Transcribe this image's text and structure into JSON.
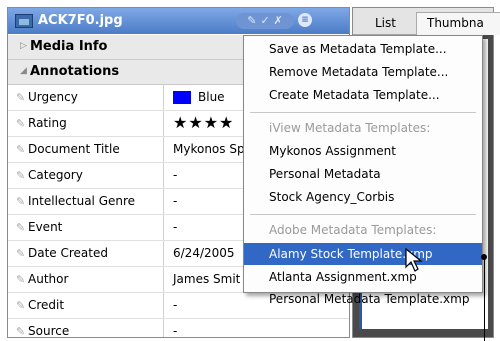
{
  "panel": {
    "filename": "ACK7F0.jpg",
    "tool_glyphs": "✓ ✗",
    "menu_glyph": "≡",
    "sections": {
      "media_info": "Media Info",
      "annotations": "Annotations"
    },
    "rows": [
      {
        "key": "Urgency",
        "value": "Blue",
        "swatch": "#0000ff"
      },
      {
        "key": "Rating",
        "value": "★★★★"
      },
      {
        "key": "Document Title",
        "value": "Mykonos Sp"
      },
      {
        "key": "Category",
        "value": "-"
      },
      {
        "key": "Intellectual Genre",
        "value": "-"
      },
      {
        "key": "Event",
        "value": "-"
      },
      {
        "key": "Date Created",
        "value": "6/24/2005"
      },
      {
        "key": "Author",
        "value": "James Smit"
      },
      {
        "key": "Credit",
        "value": "-"
      },
      {
        "key": "Source",
        "value": "-"
      }
    ]
  },
  "right_panel": {
    "tab_list": "List",
    "tab_thumbnails": "Thumbna"
  },
  "menu": {
    "items": [
      "Save as Metadata Template...",
      "Remove Metadata Template...",
      "Create Metadata Template..."
    ],
    "iview_header": "iView Metadata Templates:",
    "iview_items": [
      "Mykonos Assignment",
      "Personal Metadata",
      "Stock Agency_Corbis"
    ],
    "adobe_header": "Adobe Metadata Templates:",
    "adobe_items": [
      "Alamy Stock Template.xmp",
      "Atlanta Assignment.xmp",
      "Personal Metadata Template.xmp"
    ],
    "selected": "Alamy Stock Template.xmp"
  },
  "colors": {
    "selection": "#3167c5",
    "titlebar": "#4c7cc7"
  }
}
